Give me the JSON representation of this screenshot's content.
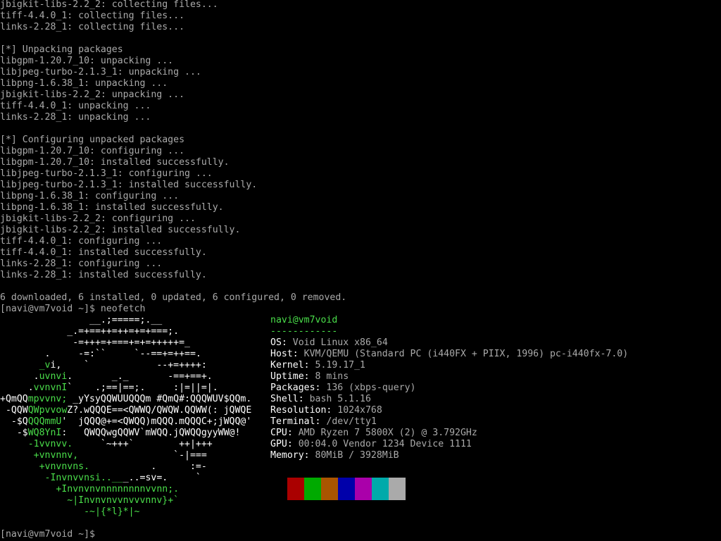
{
  "scrollback": [
    "jbigkit-libs-2.2_2: collecting files...",
    "tiff-4.4.0_1: collecting files...",
    "links-2.28_1: collecting files...",
    "",
    "[*] Unpacking packages",
    "libgpm-1.20.7_10: unpacking ...",
    "libjpeg-turbo-2.1.3_1: unpacking ...",
    "libpng-1.6.38_1: unpacking ...",
    "jbigkit-libs-2.2_2: unpacking ...",
    "tiff-4.4.0_1: unpacking ...",
    "links-2.28_1: unpacking ...",
    "",
    "[*] Configuring unpacked packages",
    "libgpm-1.20.7_10: configuring ...",
    "libgpm-1.20.7_10: installed successfully.",
    "libjpeg-turbo-2.1.3_1: configuring ...",
    "libjpeg-turbo-2.1.3_1: installed successfully.",
    "libpng-1.6.38_1: configuring ...",
    "libpng-1.6.38_1: installed successfully.",
    "jbigkit-libs-2.2_2: configuring ...",
    "jbigkit-libs-2.2_2: installed successfully.",
    "tiff-4.4.0_1: configuring ...",
    "tiff-4.4.0_1: installed successfully.",
    "links-2.28_1: configuring ...",
    "links-2.28_1: installed successfully.",
    "",
    "6 downloaded, 6 installed, 0 updated, 6 configured, 0 removed."
  ],
  "command_prompt": "[navi@vm7void ~]$ neofetch",
  "neofetch": {
    "logo": [
      "                __.;=====;.__",
      "            _.=+==++=++=+=+===;.",
      "             -=+++=+===+=+=+++++=_",
      "        .     -=:``     `--==+=++==.",
      "       _vi,    `            --+=++++:",
      "      .uvnvi.       _._       -==+==+.",
      "     .vvnvnI`    .;==|==;.     :|=||=|.",
      "+QmQQmpvvnv; _yYsyQQWUUQQQm #QmQ#:QQQWUV$QQm.",
      " -QQWQWpvvowZ?.wQQQE==<QWWQ/QWQW.QQWW(: jQWQE",
      "  -$QQQQmmU'  jQQQ@+=<QWQQ)mQQQ.mQQQC+;jWQQ@'",
      "   -$WQ8YnI:   QWQQwgQQWV`mWQQ.jQWQQgyyWW@!",
      "     -1vvnvv.     `~+++`        ++|+++",
      "      +vnvnnv,                 `-|===",
      "       +vnvnvns.           .      :=-",
      "        -Invnvvnsi..___..=sv=.     `",
      "          +Invnvnvnnnnnnnnvvnn;.",
      "            ~|Invnvnvvnvvvnnv}+`",
      "               -~|{*l}*|~"
    ],
    "user_host": "navi@vm7void",
    "separator": "------------",
    "info": [
      {
        "key": "OS",
        "value": "Void Linux x86_64"
      },
      {
        "key": "Host",
        "value": "KVM/QEMU (Standard PC (i440FX + PIIX, 1996) pc-i440fx-7.0)"
      },
      {
        "key": "Kernel",
        "value": "5.19.17_1"
      },
      {
        "key": "Uptime",
        "value": "8 mins"
      },
      {
        "key": "Packages",
        "value": "136 (xbps-query)"
      },
      {
        "key": "Shell",
        "value": "bash 5.1.16"
      },
      {
        "key": "Resolution",
        "value": "1024x768"
      },
      {
        "key": "Terminal",
        "value": "/dev/tty1"
      },
      {
        "key": "CPU",
        "value": "AMD Ryzen 7 5800X (2) @ 3.792GHz"
      },
      {
        "key": "GPU",
        "value": "00:04.0 Vendor 1234 Device 1111"
      },
      {
        "key": "Memory",
        "value": "80MiB / 3928MiB"
      }
    ],
    "palette": [
      "#000000",
      "#aa0000",
      "#00aa00",
      "#aa5500",
      "#0000aa",
      "#aa00aa",
      "#00aaaa",
      "#aaaaaa"
    ]
  },
  "final_prompt": "[navi@vm7void ~]$ "
}
